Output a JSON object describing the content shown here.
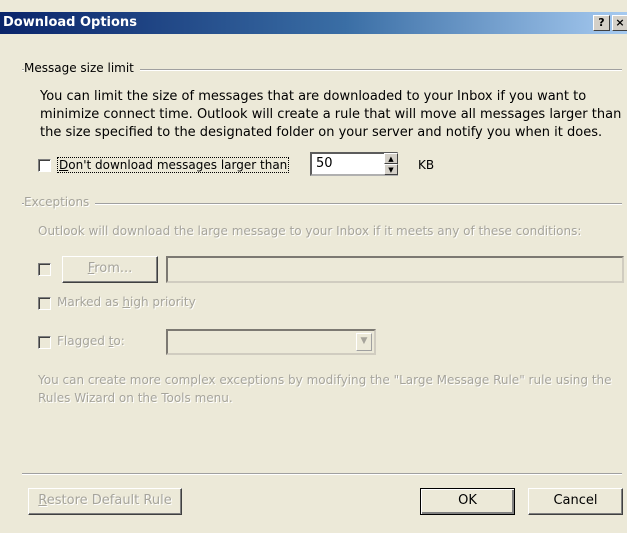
{
  "window": {
    "title": "Download Options",
    "help_glyph": "?",
    "close_glyph": "×"
  },
  "size_limit": {
    "group_label": "Message size limit",
    "description": "You can limit the size of messages that are downloaded to your Inbox if you want to minimize connect time. Outlook will create a rule that will move all messages larger than the size specified to the designated folder on your server and notify you when it does.",
    "checkbox_label": "Don't download messages larger than",
    "checkbox_checked": false,
    "size_value": "50",
    "unit": "KB"
  },
  "exceptions": {
    "group_label": "Exceptions",
    "description": "Outlook will download the large message to your Inbox if it meets any of these conditions:",
    "from_button": "From...",
    "from_value": "",
    "high_priority_label": "Marked as high priority",
    "flagged_label": "Flagged to:",
    "flagged_value": "",
    "footer_note": "You can create more complex exceptions by modifying the \"Large Message Rule\" rule using the Rules Wizard on the Tools menu."
  },
  "buttons": {
    "restore": "Restore Default Rule",
    "ok": "OK",
    "cancel": "Cancel"
  },
  "icons": {
    "spin_up": "▲",
    "spin_down": "▼",
    "combo_arrow": "▼"
  }
}
